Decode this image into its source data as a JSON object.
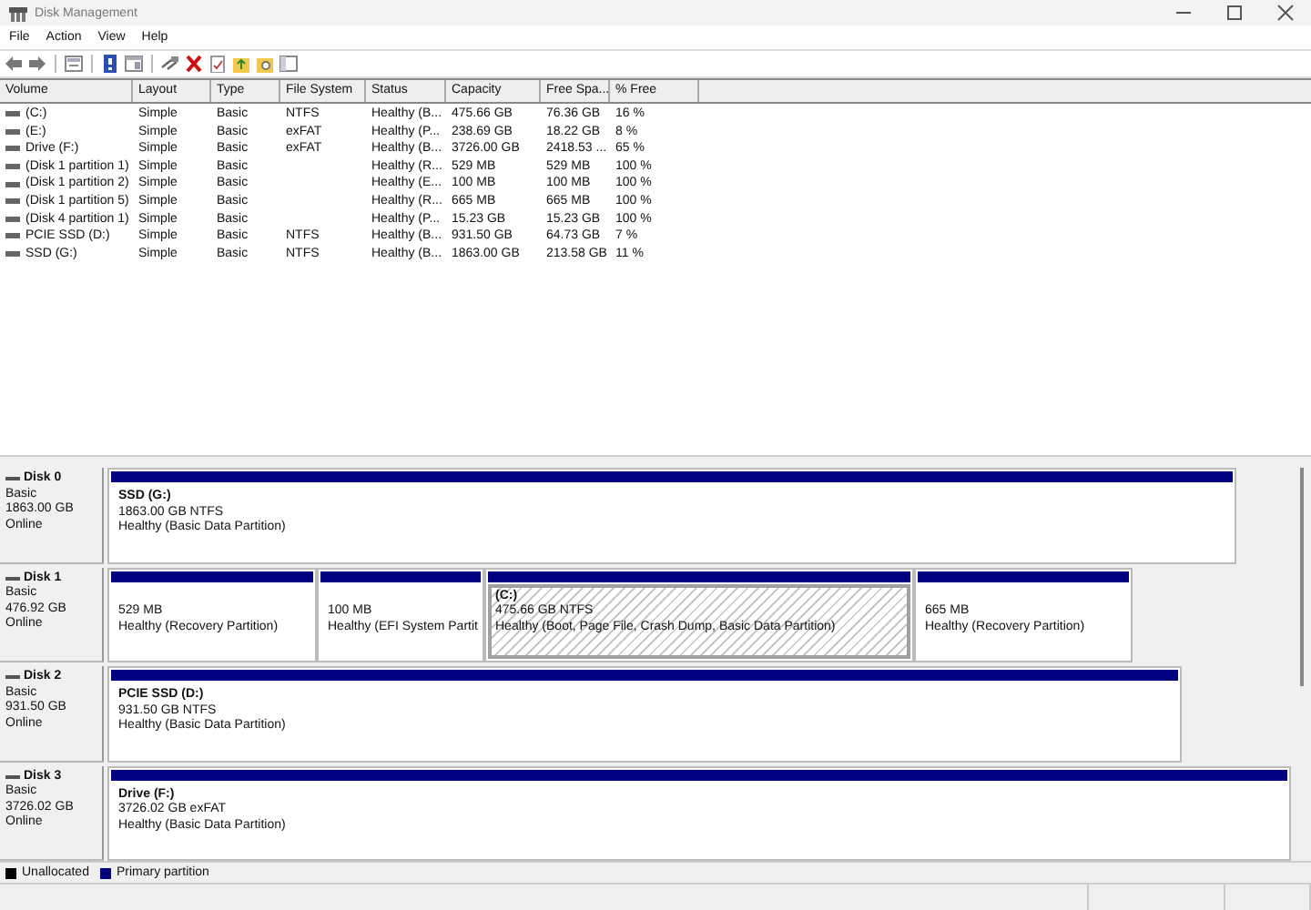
{
  "window": {
    "title": "Disk Management"
  },
  "menu": [
    "File",
    "Action",
    "View",
    "Help"
  ],
  "table": {
    "columns": [
      "Volume",
      "Layout",
      "Type",
      "File System",
      "Status",
      "Capacity",
      "Free Spa...",
      "% Free"
    ],
    "rows": [
      [
        "(C:)",
        "Simple",
        "Basic",
        "NTFS",
        "Healthy (B...",
        "475.66 GB",
        "76.36 GB",
        "16 %"
      ],
      [
        "(E:)",
        "Simple",
        "Basic",
        "exFAT",
        "Healthy (P...",
        "238.69 GB",
        "18.22 GB",
        "8 %"
      ],
      [
        "Drive (F:)",
        "Simple",
        "Basic",
        "exFAT",
        "Healthy (B...",
        "3726.00 GB",
        "2418.53 ...",
        "65 %"
      ],
      [
        "(Disk 1 partition 1)",
        "Simple",
        "Basic",
        "",
        "Healthy (R...",
        "529 MB",
        "529 MB",
        "100 %"
      ],
      [
        "(Disk 1 partition 2)",
        "Simple",
        "Basic",
        "",
        "Healthy (E...",
        "100 MB",
        "100 MB",
        "100 %"
      ],
      [
        "(Disk 1 partition 5)",
        "Simple",
        "Basic",
        "",
        "Healthy (R...",
        "665 MB",
        "665 MB",
        "100 %"
      ],
      [
        "(Disk 4 partition 1)",
        "Simple",
        "Basic",
        "",
        "Healthy (P...",
        "15.23 GB",
        "15.23 GB",
        "100 %"
      ],
      [
        "PCIE SSD (D:)",
        "Simple",
        "Basic",
        "NTFS",
        "Healthy (B...",
        "931.50 GB",
        "64.73 GB",
        "7 %"
      ],
      [
        "SSD (G:)",
        "Simple",
        "Basic",
        "NTFS",
        "Healthy (B...",
        "1863.00 GB",
        "213.58 GB",
        "11 %"
      ]
    ]
  },
  "disks": [
    {
      "name": "Disk 0",
      "type": "Basic",
      "size": "1863.00 GB",
      "status": "Online",
      "partitions": [
        {
          "label": "SSD  (G:)",
          "size": "1863.00 GB NTFS",
          "status": "Healthy (Basic Data Partition)",
          "selected": false
        }
      ]
    },
    {
      "name": "Disk 1",
      "type": "Basic",
      "size": "476.92 GB",
      "status": "Online",
      "partitions": [
        {
          "size": "529 MB",
          "status": "Healthy (Recovery Partition)",
          "selected": false
        },
        {
          "size": "100 MB",
          "status": "Healthy (EFI System Partit",
          "selected": false
        },
        {
          "label": "(C:)",
          "size": "475.66 GB NTFS",
          "status": "Healthy (Boot, Page File, Crash Dump, Basic Data Partition)",
          "selected": true
        },
        {
          "size": "665 MB",
          "status": "Healthy (Recovery Partition)",
          "selected": false
        }
      ]
    },
    {
      "name": "Disk 2",
      "type": "Basic",
      "size": "931.50 GB",
      "status": "Online",
      "partitions": [
        {
          "label": "PCIE SSD  (D:)",
          "size": "931.50 GB NTFS",
          "status": "Healthy (Basic Data Partition)",
          "selected": false
        }
      ]
    },
    {
      "name": "Disk 3",
      "type": "Basic",
      "size": "3726.02 GB",
      "status": "Online",
      "partitions": [
        {
          "label": "Drive  (F:)",
          "size": "3726.02 GB exFAT",
          "status": "Healthy (Basic Data Partition)",
          "selected": false
        }
      ]
    }
  ],
  "legend": [
    {
      "label": "Unallocated",
      "color": "#000000"
    },
    {
      "label": "Primary partition",
      "color": "#000080"
    }
  ]
}
